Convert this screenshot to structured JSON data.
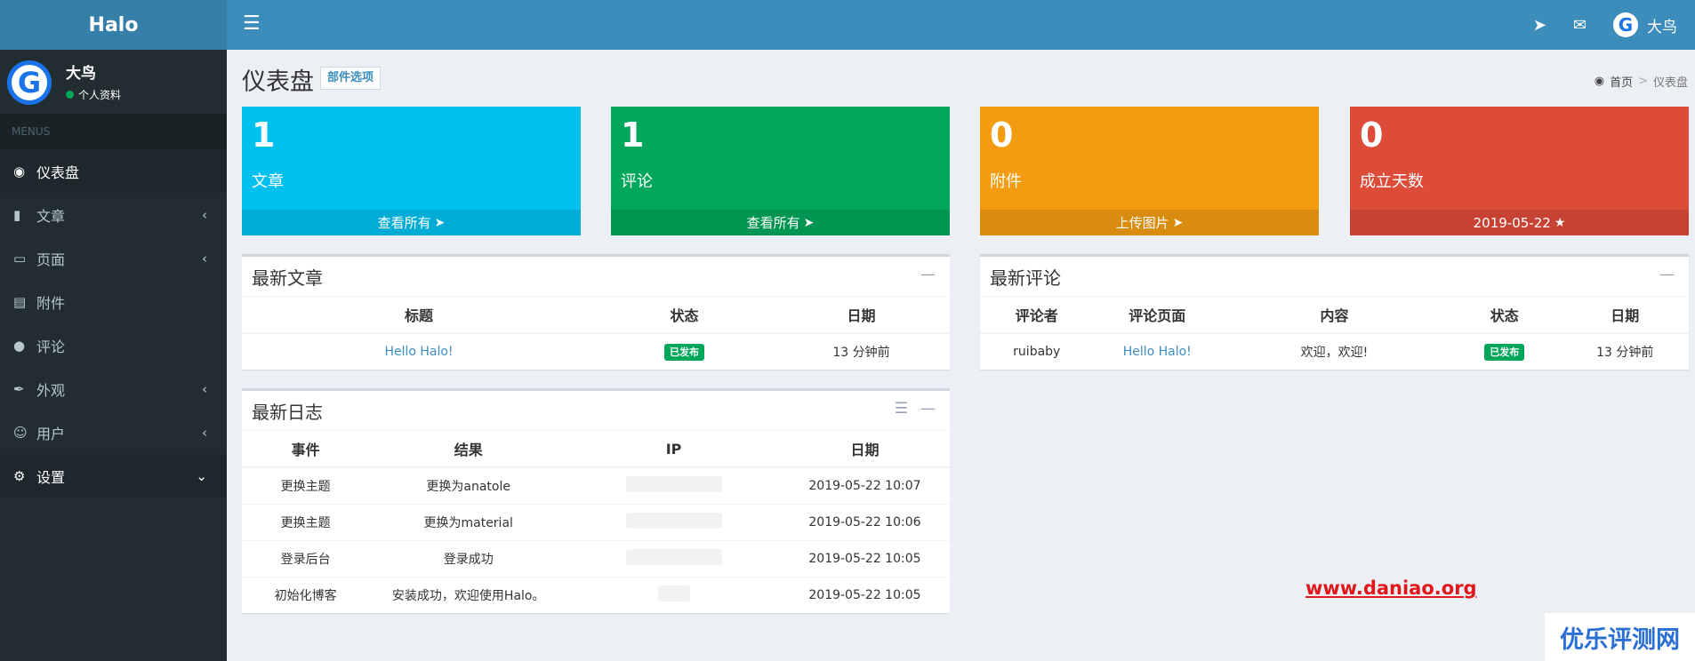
{
  "header": {
    "logo": "Halo",
    "menu_icon": "bars-icon",
    "user_name": "大鸟"
  },
  "sidebar": {
    "user": {
      "name": "大鸟",
      "status": "个人资料"
    },
    "menu_header": "MENUS",
    "items": [
      {
        "label": "仪表盘",
        "icon": "dashboard-icon",
        "active": true
      },
      {
        "label": "文章",
        "icon": "book-icon"
      },
      {
        "label": "页面",
        "icon": "desktop-icon"
      },
      {
        "label": "附件",
        "icon": "image-icon"
      },
      {
        "label": "评论",
        "icon": "comment-icon"
      },
      {
        "label": "外观",
        "icon": "paint-brush-icon"
      },
      {
        "label": "用户",
        "icon": "user-icon"
      },
      {
        "label": "设置",
        "icon": "gear-icon",
        "expanded": true
      }
    ]
  },
  "page": {
    "title": "仪表盘",
    "widget_button": "部件选项",
    "breadcrumb": {
      "home": "首页",
      "current": "仪表盘"
    }
  },
  "stats": [
    {
      "value": "1",
      "label": "文章",
      "footer": "查看所有",
      "color": "#00c0ef"
    },
    {
      "value": "1",
      "label": "评论",
      "footer": "查看所有",
      "color": "#00a65a"
    },
    {
      "value": "0",
      "label": "附件",
      "footer": "上传图片",
      "color": "#f39c12"
    },
    {
      "value": "0",
      "label": "成立天数",
      "footer": "2019-05-22",
      "color": "#dd4b39"
    }
  ],
  "latest_posts": {
    "title": "最新文章",
    "columns": [
      "标题",
      "状态",
      "日期"
    ],
    "rows": [
      {
        "title": "Hello Halo!",
        "status": "已发布",
        "date": "13 分钟前"
      }
    ]
  },
  "latest_comments": {
    "title": "最新评论",
    "columns": [
      "评论者",
      "评论页面",
      "内容",
      "状态",
      "日期"
    ],
    "rows": [
      {
        "author": "ruibaby",
        "page": "Hello Halo!",
        "content": "欢迎，欢迎!",
        "status": "已发布",
        "date": "13 分钟前"
      }
    ]
  },
  "latest_logs": {
    "title": "最新日志",
    "columns": [
      "事件",
      "结果",
      "IP",
      "日期"
    ],
    "rows": [
      {
        "event": "更换主题",
        "result": "更换为anatole",
        "date": "2019-05-22 10:07"
      },
      {
        "event": "更换主题",
        "result": "更换为material",
        "date": "2019-05-22 10:06"
      },
      {
        "event": "登录后台",
        "result": "登录成功",
        "date": "2019-05-22 10:05"
      },
      {
        "event": "初始化博客",
        "result": "安装成功，欢迎使用Halo。",
        "date": "2019-05-22 10:05"
      }
    ]
  },
  "watermark": "www.daniao.org",
  "corner_logo": "优乐评测网"
}
